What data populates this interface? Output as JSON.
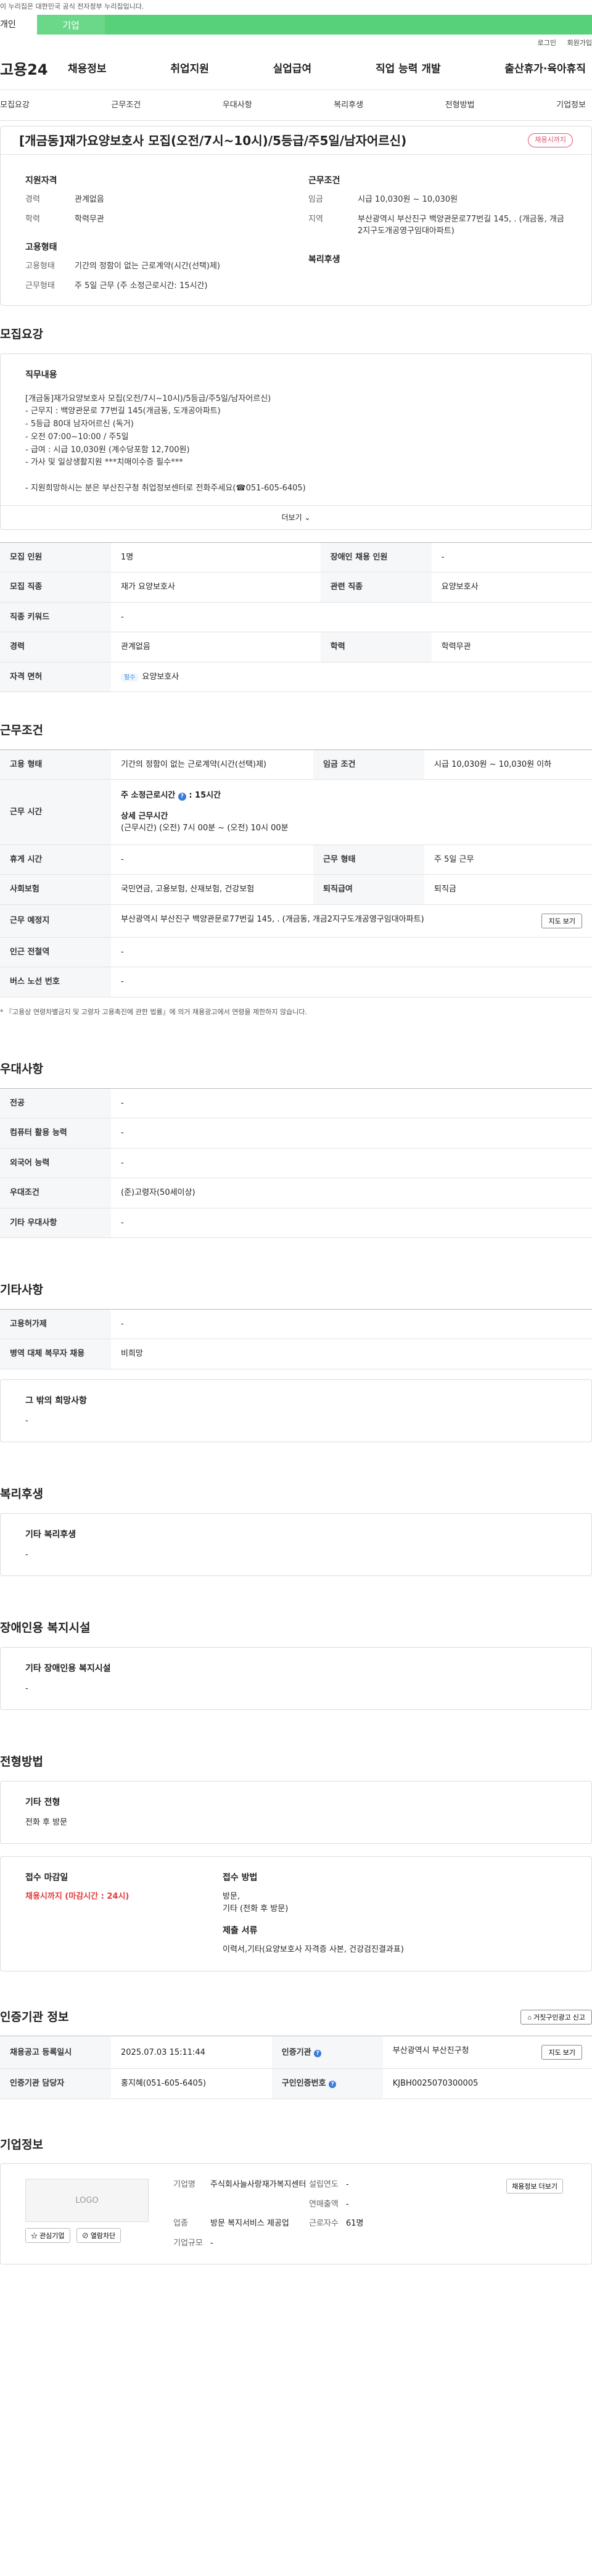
{
  "topbar": {
    "text": "이 누리집은 대한민국 공식 전자정부 누리집입니다."
  },
  "tabs": [
    "개인",
    "기업"
  ],
  "util": [
    "로그인",
    "회원가입"
  ],
  "site": {
    "logo": "고용24"
  },
  "gnb": [
    "채용정보",
    "취업지원",
    "실업급여",
    "직업 능력 개발",
    "출산휴가·육아휴직"
  ],
  "anchors": [
    "모집요강",
    "근무조건",
    "우대사항",
    "복리후생",
    "전형방법",
    "기업정보"
  ],
  "summary": {
    "title": "[개금동]재가요양보호사 모집(오전/7시~10시)/5등급/주5일/남자어르신)",
    "badge": "채용시까지",
    "qual_title": "지원자격",
    "career_k": "경력",
    "career_v": "관계없음",
    "edu_k": "학력",
    "edu_v": "학력무관",
    "emp_title": "고용형태",
    "emptype_k": "고용형태",
    "emptype_v": "기간의 정함이 없는 근로계약(시간(선택)제)",
    "work_k": "근무형태",
    "work_v": "주 5일 근무 (주 소정근로시간: 15시간)",
    "cond_title": "근무조건",
    "wage_k": "임금",
    "wage_v": "시급 10,030원 ~ 10,030원",
    "area_k": "지역",
    "area_v": "부산광역시 부산진구 백양관문로77번길 145, . (개금동, 개금2지구도개공영구임대아파트)",
    "welfare_title": "복리후생"
  },
  "recruit": {
    "section": "모집요강",
    "duty_title": "직무내용",
    "duty_text": "[개금동]재가요양보호사 모집(오전/7시~10시)/5등급/주5일/남자어르신)\n- 근무지 : 백양관문로 77번길 145(개금동, 도개공아파트)\n- 5등급 80대 남자어르신 (독거)\n- 오전  07:00~10:00 / 주5일\n- 급여 : 시급 10,030원 (계수당포함 12,700원)\n- 가사 및 일상생활지원 ***치매이수증 필수***\n\n- 지원희망하시는 분은 부산진구청 취업정보센터로 전화주세요(☎051-605-6405)",
    "more": "더보기",
    "rows": [
      {
        "k1": "모집 인원",
        "v1": "1명",
        "k2": "장애인 채용 인원",
        "v2": "-"
      },
      {
        "k1": "모집 직종",
        "v1": "재가 요양보호사",
        "k2": "관련 직종",
        "v2": "요양보호사"
      },
      {
        "k1": "직종 키워드",
        "v1": "-"
      },
      {
        "k1": "경력",
        "v1": "관계없음",
        "k2": "학력",
        "v2": "학력무관"
      },
      {
        "k1": "자격 면허",
        "v1": "요양보호사",
        "tag": "필수"
      }
    ]
  },
  "conditions": {
    "section": "근무조건",
    "emptype_k": "고용 형태",
    "emptype_v": "기간의 정함이 없는 근로계약(시간(선택)제)",
    "wage_k": "임금 조건",
    "wage_v": "시급 10,030원 ~ 10,030원 이하",
    "hours_k": "근무 시간",
    "hours_main": "주 소정근로시간",
    "hours_val": ": 15시간",
    "hours_detail_title": "상세 근무시간",
    "hours_detail": "(근무시간) (오전) 7시 00분 ~ (오전) 10시 00분",
    "rest_k": "휴게 시간",
    "rest_v": "-",
    "form_k": "근무 형태",
    "form_v": "주 5일 근무",
    "ins_k": "사회보험",
    "ins_v": "국민연금, 고용보험, 산재보험, 건강보험",
    "ret_k": "퇴직급여",
    "ret_v": "퇴직금",
    "place_k": "근무 예정지",
    "place_v": "부산광역시 부산진구 백양관문로77번길 145, . (개금동, 개금2지구도개공영구임대아파트)",
    "map_btn": "지도 보기",
    "subway_k": "인근 전철역",
    "subway_v": "-",
    "bus_k": "버스 노선 번호",
    "bus_v": "-",
    "note": "* 『고용상 연령차별금지 및 고령자 고용촉진에 관한 법률』에 의거 채용광고에서 연령을 제한하지 않습니다."
  },
  "pref": {
    "section": "우대사항",
    "rows": [
      {
        "k": "전공",
        "v": "-"
      },
      {
        "k": "컴퓨터 활용 능력",
        "v": "-"
      },
      {
        "k": "외국어 능력",
        "v": "-"
      },
      {
        "k": "우대조건",
        "v": "(준)고령자(50세이상)"
      },
      {
        "k": "기타 우대사항",
        "v": "-"
      }
    ]
  },
  "etc": {
    "section": "기타사항",
    "rows": [
      {
        "k": "고용허가제",
        "v": "-"
      },
      {
        "k": "병역 대체 복무자 채용",
        "v": "비희망"
      }
    ],
    "box_title": "그 밖의 희망사항",
    "box_v": "-"
  },
  "welfare": {
    "section": "복리후생",
    "box_title": "기타 복리후생",
    "box_v": "-"
  },
  "disabled": {
    "section": "장애인용 복지시설",
    "box_title": "기타 장애인용 복지시설",
    "box_v": "-"
  },
  "screening": {
    "section": "전형방법",
    "box_title": "기타 전형",
    "box_v": "전화 후 방문",
    "deadline_k": "접수 마감일",
    "deadline_v": "채용시까지 (마감시간 : 24시)",
    "method_k": "접수 방법",
    "method_v": "방문,\n기타 (전화 후 방문)",
    "docs_k": "제출 서류",
    "docs_v": "이력서,기타(요양보호사 자격증 사본, 건강검진결과표)"
  },
  "agency": {
    "section": "인증기관 정보",
    "report_btn": "거짓구인광고 신고",
    "reg_k": "채용공고 등록일시",
    "reg_v": "2025.07.03 15:11:44",
    "org_k": "인증기관",
    "org_v": "부산광역시 부산진구청",
    "map_btn": "지도 보기",
    "mgr_k": "인증기관 담당자",
    "mgr_v": "홍지혜(051-605-6405)",
    "no_k": "구인인증번호",
    "no_v": "KJBH0025070300005"
  },
  "company": {
    "section": "기업정보",
    "logo": "LOGO",
    "fav_btn": "관심기업",
    "block_btn": "열람차단",
    "name_k": "기업명",
    "name_v": "주식회사늘사랑재가복지센터",
    "est_k": "설립연도",
    "est_v": "-",
    "sales_k": "연매출액",
    "sales_v": "-",
    "ind_k": "업종",
    "ind_v": "방문 복지서비스 제공업",
    "emp_k": "근로자수",
    "emp_v": "61명",
    "size_k": "기업규모",
    "size_v": "-",
    "jobs_btn": "채용정보 더보기"
  }
}
